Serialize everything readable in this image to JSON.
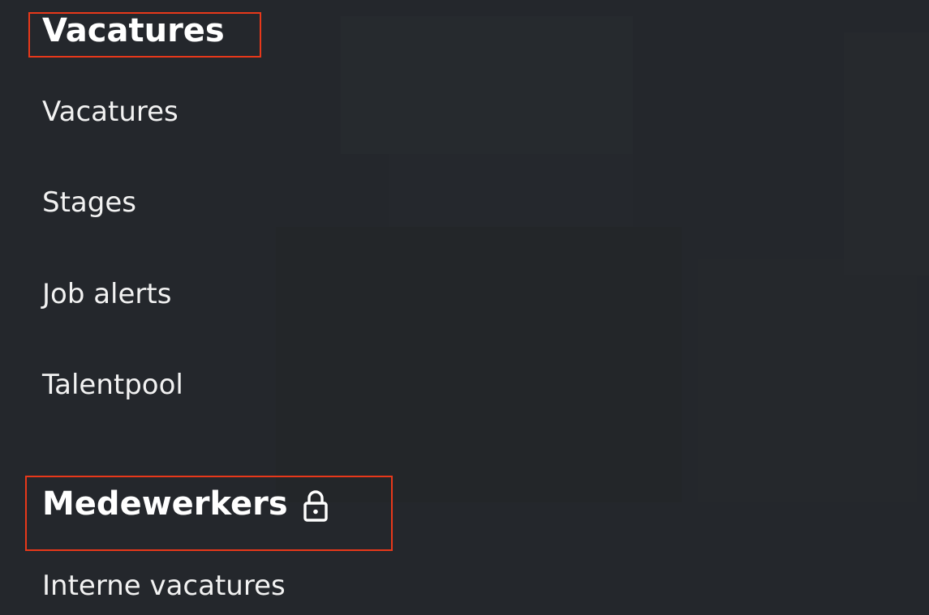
{
  "sections": [
    {
      "title": "Vacatures",
      "links": [
        "Vacatures",
        "Stages",
        "Job alerts",
        "Talentpool"
      ]
    },
    {
      "title": "Medewerkers",
      "icon": "lock-icon",
      "links": [
        "Interne vacatures"
      ]
    }
  ],
  "colors": {
    "background": "#24272c",
    "text": "#ffffff",
    "highlight": "#e8381a"
  }
}
